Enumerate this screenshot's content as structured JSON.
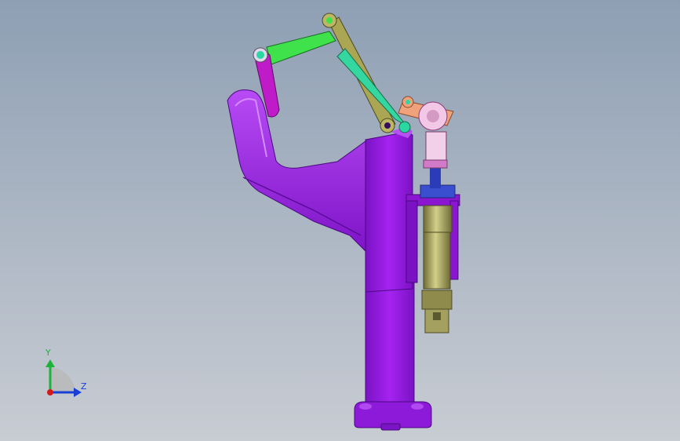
{
  "viewport": {
    "background_top": "#8e9fb4",
    "background_bottom": "#c8ccd3"
  },
  "model": {
    "body_color": "#9a1ce6",
    "body_shadow": "#6c0fb0",
    "link_green": "#3fe24a",
    "link_olive": "#b9b35a",
    "link_magenta": "#c01bc8",
    "cylinder_color": "#a7a46b",
    "rod_color": "#f0a27a",
    "rod_end_color": "#f2c6e6"
  },
  "triad": {
    "y_label": "Y",
    "z_label": "Z",
    "y_color": "#1db33a",
    "z_color": "#1a3fd6",
    "x_color": "#d61a1a"
  }
}
